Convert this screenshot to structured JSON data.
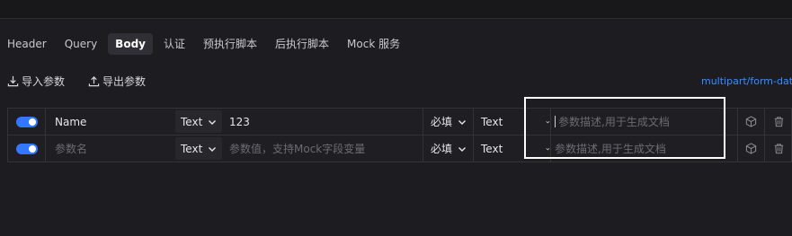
{
  "tabs": [
    {
      "label": "Header"
    },
    {
      "label": "Query"
    },
    {
      "label": "Body"
    },
    {
      "label": "认证"
    },
    {
      "label": "预执行脚本"
    },
    {
      "label": "后执行脚本"
    },
    {
      "label": "Mock 服务"
    }
  ],
  "active_tab": "Body",
  "actions": {
    "import_label": "导入参数",
    "export_label": "导出参数"
  },
  "content_type": "multipart/form-data",
  "rows": [
    {
      "enabled": true,
      "name": "Name",
      "name_placeholder": "",
      "type": "Text",
      "value": "123",
      "value_placeholder": "",
      "required": "必填",
      "value_type": "Text",
      "description_placeholder": "参数描述,用于生成文档"
    },
    {
      "enabled": true,
      "name": "",
      "name_placeholder": "参数名",
      "type": "Text",
      "value": "",
      "value_placeholder": "参数值，支持Mock字段变量",
      "required": "必填",
      "value_type": "Text",
      "description_placeholder": "参数描述,用于生成文档"
    }
  ],
  "icons": {
    "import": "import-icon",
    "export": "export-icon",
    "mock": "cube-icon",
    "delete": "trash-icon"
  },
  "colors": {
    "background": "#1d1d21",
    "accent": "#3377ff",
    "link": "#3b8cff"
  }
}
